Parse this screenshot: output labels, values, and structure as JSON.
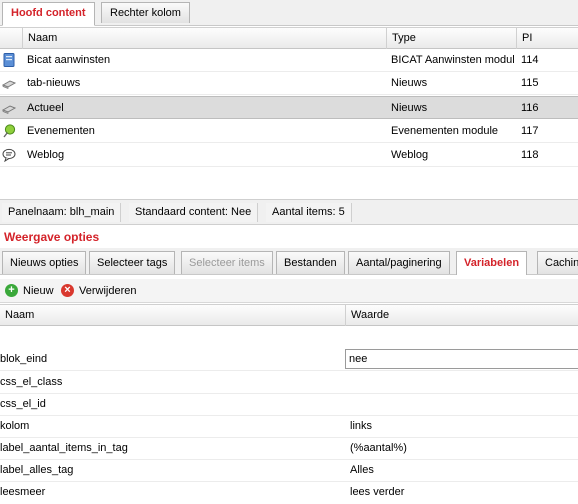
{
  "top_tabs": [
    {
      "label": "Hoofd content",
      "active": true
    },
    {
      "label": "Rechter kolom",
      "active": false
    }
  ],
  "content_grid": {
    "columns": [
      "Naam",
      "Type",
      "PI"
    ],
    "rows": [
      {
        "icon": "book-icon",
        "naam": "Bicat aanwinsten",
        "type": "BICAT Aanwinsten module",
        "pi": "114"
      },
      {
        "icon": "newspaper-icon",
        "naam": "tab-nieuws",
        "type": "Nieuws",
        "pi": "115"
      },
      {
        "icon": "newspaper-icon",
        "naam": "Actueel",
        "type": "Nieuws",
        "pi": "116",
        "selected": true
      },
      {
        "icon": "event-pin-icon",
        "naam": "Evenementen",
        "type": "Evenementen module",
        "pi": "117"
      },
      {
        "icon": "speech-bubble-icon",
        "naam": "Weblog",
        "type": "Weblog",
        "pi": "118"
      }
    ]
  },
  "status_bar": {
    "panel_name": "Panelnaam: blh_main",
    "default_content": "Standaard content: Nee",
    "item_count": "Aantal items: 5"
  },
  "section_title": "Weergave opties",
  "sub_tabs": [
    {
      "label": "Nieuws opties",
      "state": "normal"
    },
    {
      "label": "Selecteer tags",
      "state": "normal"
    },
    {
      "label": "Selecteer items",
      "state": "disabled"
    },
    {
      "label": "Bestanden",
      "state": "normal"
    },
    {
      "label": "Aantal/paginering",
      "state": "normal"
    },
    {
      "label": "Variabelen",
      "state": "active"
    },
    {
      "label": "Cachin",
      "state": "normal"
    }
  ],
  "toolbar": {
    "add_label": "Nieuw",
    "delete_label": "Verwijderen"
  },
  "variables_grid": {
    "columns": [
      "Naam",
      "Waarde"
    ],
    "rows": [
      {
        "naam": "blok_eind",
        "waarde": "nee",
        "editing": true
      },
      {
        "naam": "css_el_class",
        "waarde": ""
      },
      {
        "naam": "css_el_id",
        "waarde": ""
      },
      {
        "naam": "kolom",
        "waarde": "links"
      },
      {
        "naam": "label_aantal_items_in_tag",
        "waarde": "(%aantal%)"
      },
      {
        "naam": "label_alles_tag",
        "waarde": "Alles"
      },
      {
        "naam": "leesmeer",
        "waarde": "lees verder"
      }
    ]
  },
  "colors": {
    "accent": "#d4232a",
    "selected_row": "#dcdcdc"
  }
}
